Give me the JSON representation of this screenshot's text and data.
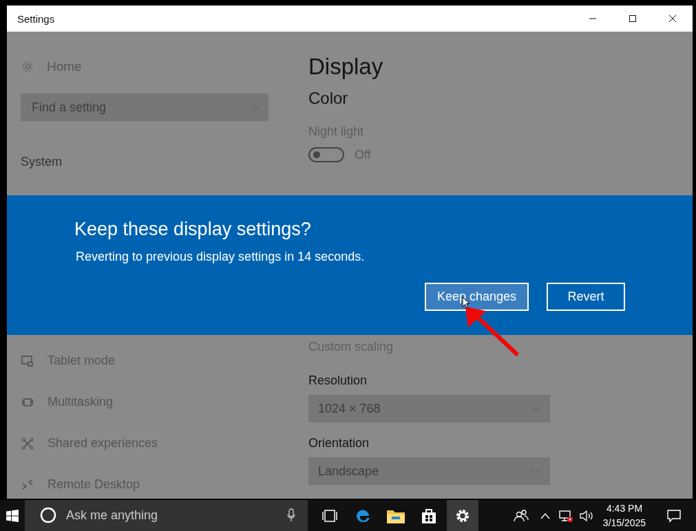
{
  "window": {
    "title": "Settings"
  },
  "sidebar": {
    "home": "Home",
    "search": {
      "placeholder": "Find a setting"
    },
    "section": "System",
    "items": [
      {
        "label": "Tablet mode"
      },
      {
        "label": "Multitasking"
      },
      {
        "label": "Shared experiences"
      },
      {
        "label": "Remote Desktop"
      }
    ]
  },
  "content": {
    "title": "Display",
    "section": "Color",
    "night_light": {
      "label": "Night light",
      "on": false,
      "state_text": "Off"
    },
    "custom_scaling": "Custom scaling",
    "dropdowns": [
      {
        "label": "Resolution",
        "value": "1024 × 768"
      },
      {
        "label": "Orientation",
        "value": "Landscape"
      }
    ]
  },
  "dialog": {
    "title": "Keep these display settings?",
    "message": "Reverting to previous display settings in 14 seconds.",
    "buttons": [
      {
        "label": "Keep changes",
        "hovered": true
      },
      {
        "label": "Revert",
        "hovered": false
      }
    ]
  },
  "taskbar": {
    "search": {
      "placeholder": "Ask me anything"
    },
    "time": "4:43 PM",
    "date": "3/15/2025"
  }
}
